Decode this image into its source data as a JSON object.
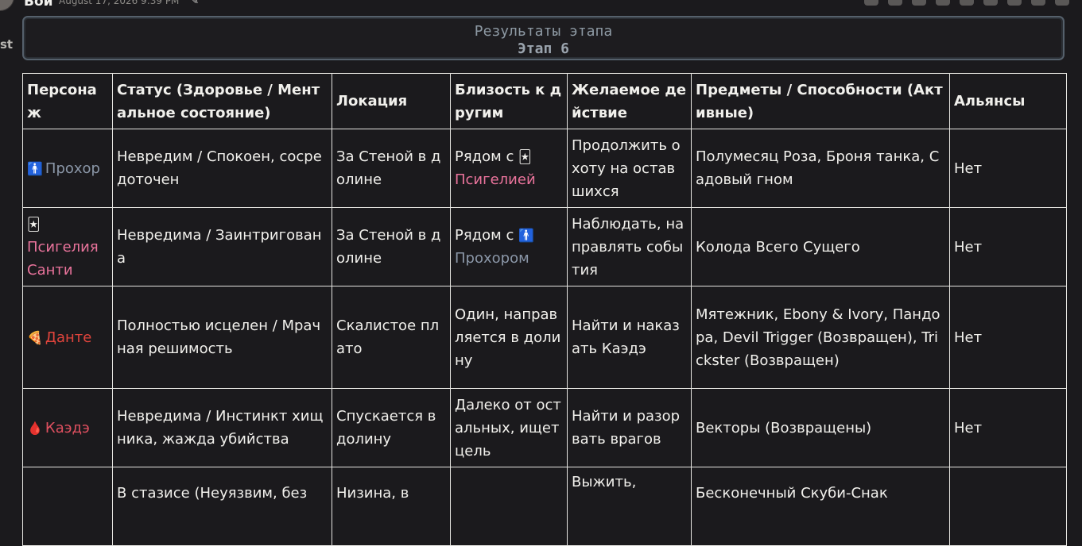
{
  "message": {
    "author": "Бой",
    "timestamp": "August 17, 2026 9:39 PM",
    "side_text": "st"
  },
  "banner": {
    "line1": "Результаты этапа",
    "line2": "Этап 6"
  },
  "table": {
    "headers": [
      "Персонаж",
      "Статус (Здоровье / Ментальное состояние)",
      "Локация",
      "Близость к другим",
      "Желаемое действие",
      "Предметы / Способности (Активные)",
      "Альянсы"
    ],
    "rows": [
      {
        "emoji": "🚹",
        "name": "Прохор",
        "status": "Невредим / Спокоен, сосредоточен",
        "location": "За Стеной в долине",
        "proximity_prefix": "Рядом с",
        "proximity_emoji": "🃏",
        "proximity_name": "Псигелией",
        "action": "Продолжить охоту на оставшихся",
        "items": "Полумесяц Роза, Броня танка, Садовый гном",
        "alliances": "Нет"
      },
      {
        "emoji": "🃏",
        "name": "Псигелия Санти",
        "status": "Невредима / Заинтригована",
        "location": "За Стеной в долине",
        "proximity_prefix": "Рядом с",
        "proximity_emoji": "🚹",
        "proximity_name": "Прохором",
        "action": "Наблюдать, направлять события",
        "items": "Колода Всего Сущего",
        "alliances": "Нет"
      },
      {
        "emoji": "🍕",
        "name": "Данте",
        "status": "Полностью исцелен / Мрачная решимость",
        "location": "Скалистое плато",
        "proximity": "Один, направляется в долину",
        "action": "Найти и наказать Каэдэ",
        "items": "Мятежник, Ebony & Ivory, Пандора, Devil Trigger (Возвращен), Trickster (Возвращен)",
        "alliances": "Нет"
      },
      {
        "emoji": "🩸",
        "name": "Каэдэ",
        "status": "Невредима / Инстинкт хищника, жажда убийства",
        "location": "Спускается в долину",
        "proximity": "Далеко от остальных, ищет цель",
        "action": "Найти и разорвать врагов",
        "items": "Векторы (Возвращены)",
        "alliances": "Нет"
      },
      {
        "status": "В стазисе (Неуязвим, без",
        "location": "Низина, в",
        "action": "Выжить,",
        "items": "Бесконечный Скуби-Снак"
      }
    ]
  }
}
